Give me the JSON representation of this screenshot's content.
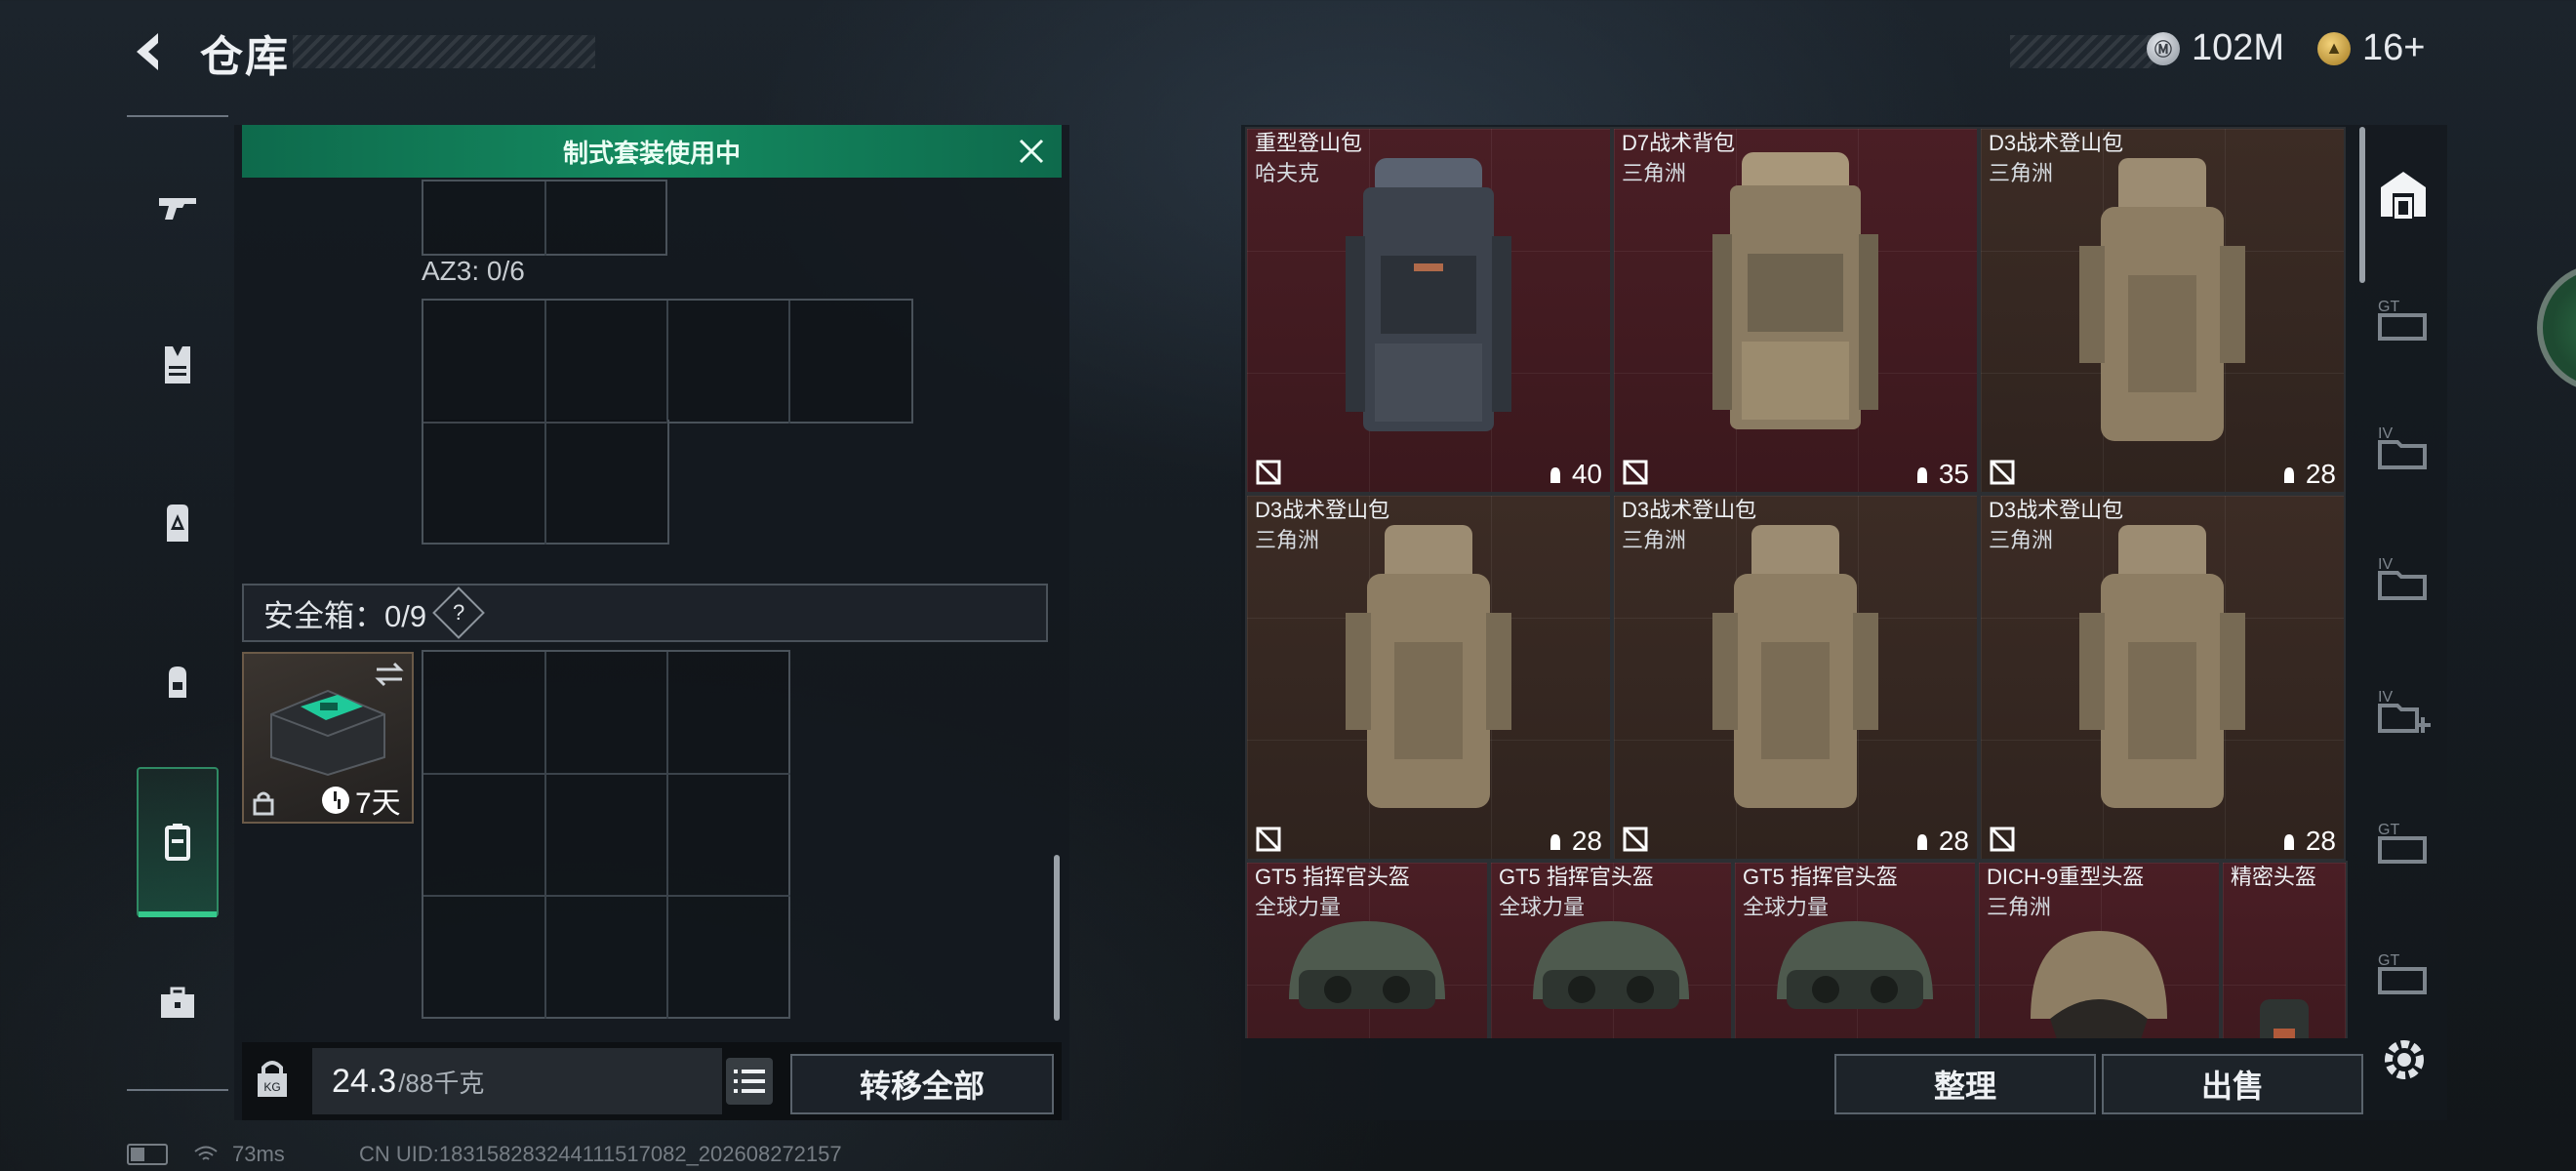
{
  "header": {
    "title": "仓库"
  },
  "currency": [
    {
      "icon": "silver-coin-icon",
      "value": "102M"
    },
    {
      "icon": "triangle-coin-icon",
      "value": "16+"
    }
  ],
  "left_nav": {
    "items": [
      "gun-icon",
      "vest-icon",
      "backpack-a-icon",
      "backpack-icon",
      "container-icon",
      "briefcase-icon"
    ],
    "selected": "container-icon"
  },
  "loadout": {
    "banner": "制式套装使用中",
    "az3_label": "AZ3: 0/6",
    "safe_label": "安全箱：0/9",
    "safe_help": "?",
    "safe_case_time": "7天"
  },
  "bottom_left": {
    "weight": "24.3",
    "weight_max": "/88千克",
    "transfer_label": "转移全部"
  },
  "items": [
    {
      "name": "重型登山包",
      "sub": "哈夫克",
      "durability": "40",
      "style": "dark"
    },
    {
      "name": "D7战术背包",
      "sub": "三角洲",
      "durability": "35",
      "style": "tan"
    },
    {
      "name": "D3战术登山包",
      "sub": "三角洲",
      "durability": "28",
      "style": "tan"
    },
    {
      "name": "D3战术登山包",
      "sub": "三角洲",
      "durability": "28",
      "style": "tan"
    },
    {
      "name": "D3战术登山包",
      "sub": "三角洲",
      "durability": "28",
      "style": "tan"
    },
    {
      "name": "D3战术登山包",
      "sub": "三角洲",
      "durability": "28",
      "style": "tan"
    },
    {
      "name": "GT5 指挥官头盔",
      "sub": "全球力量"
    },
    {
      "name": "GT5 指挥官头盔",
      "sub": "全球力量"
    },
    {
      "name": "GT5 指挥官头盔",
      "sub": "全球力量"
    },
    {
      "name": "DICH-9重型头盔",
      "sub": "三角洲"
    },
    {
      "name": "精密头盔",
      "sub": ""
    }
  ],
  "actions": {
    "sort_label": "整理",
    "sell_label": "出售"
  },
  "status": {
    "ping": "73ms",
    "uid": "CN UID:183158283244111517082_202608272157"
  },
  "colors": {
    "accent_green": "#148a60",
    "item_red": "#4a1e25"
  }
}
